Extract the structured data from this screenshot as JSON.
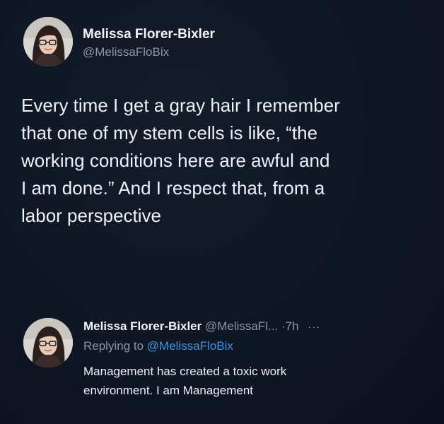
{
  "tweet": {
    "author_name": "Melissa Florer-Bixler",
    "author_handle": "@MelissaFloBix",
    "body_lines": [
      "Every time I get a gray hair I remember",
      "that one of my stem cells is like, “the",
      "working conditions here are awful and",
      "I am done.” And I respect that, from a",
      "labor perspective"
    ]
  },
  "reply": {
    "author_name": "Melissa Florer-Bixler",
    "author_handle": "@MelissaFl...",
    "separator": "·",
    "time": "7h",
    "more_glyph": "···",
    "replying_prefix": "Replying to",
    "replying_handle": "@MelissaFloBix",
    "body_lines": [
      "Management has created a toxic work",
      "environment. I am Management"
    ]
  },
  "icons": {
    "avatar": "profile-photo-icon",
    "more": "more-options-icon"
  },
  "colors": {
    "background": "#0f1624",
    "text": "#eef1f5",
    "muted": "#8b98a7",
    "link": "#3d95e6"
  }
}
